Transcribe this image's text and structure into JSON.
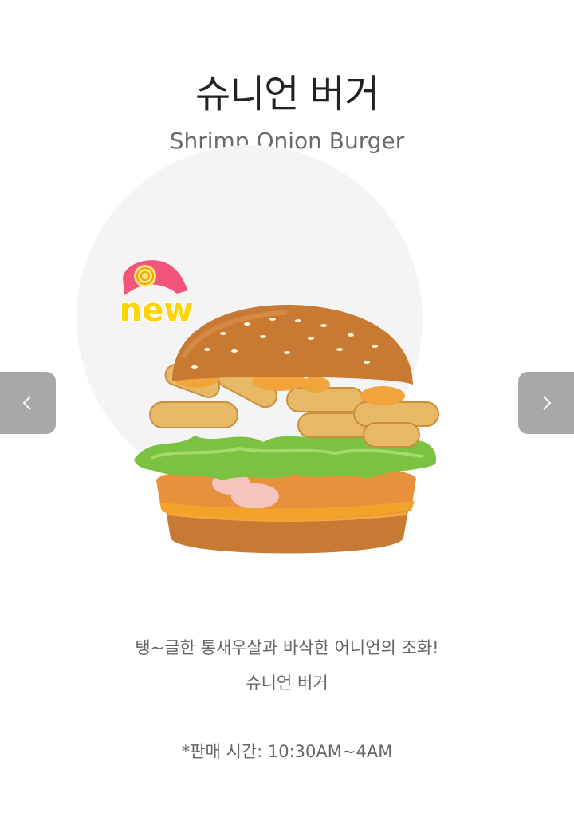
{
  "product": {
    "title_ko": "슈니언 버거",
    "title_en": "Shrimp Onion Burger",
    "badge": "new",
    "description": "탱~글한 통새우살과 바삭한 어니언의 조화!",
    "description_name": "슈니언 버거",
    "hours": "*판매 시간: 10:30AM~4AM"
  },
  "navigation": {
    "prev_icon": "chevron-left-icon",
    "next_icon": "chevron-right-icon"
  },
  "colors": {
    "nav_bg": "#a8a8a8",
    "circle_bg": "#f4f4f4",
    "badge_yellow": "#ffd400",
    "badge_pink": "#f2557a"
  }
}
